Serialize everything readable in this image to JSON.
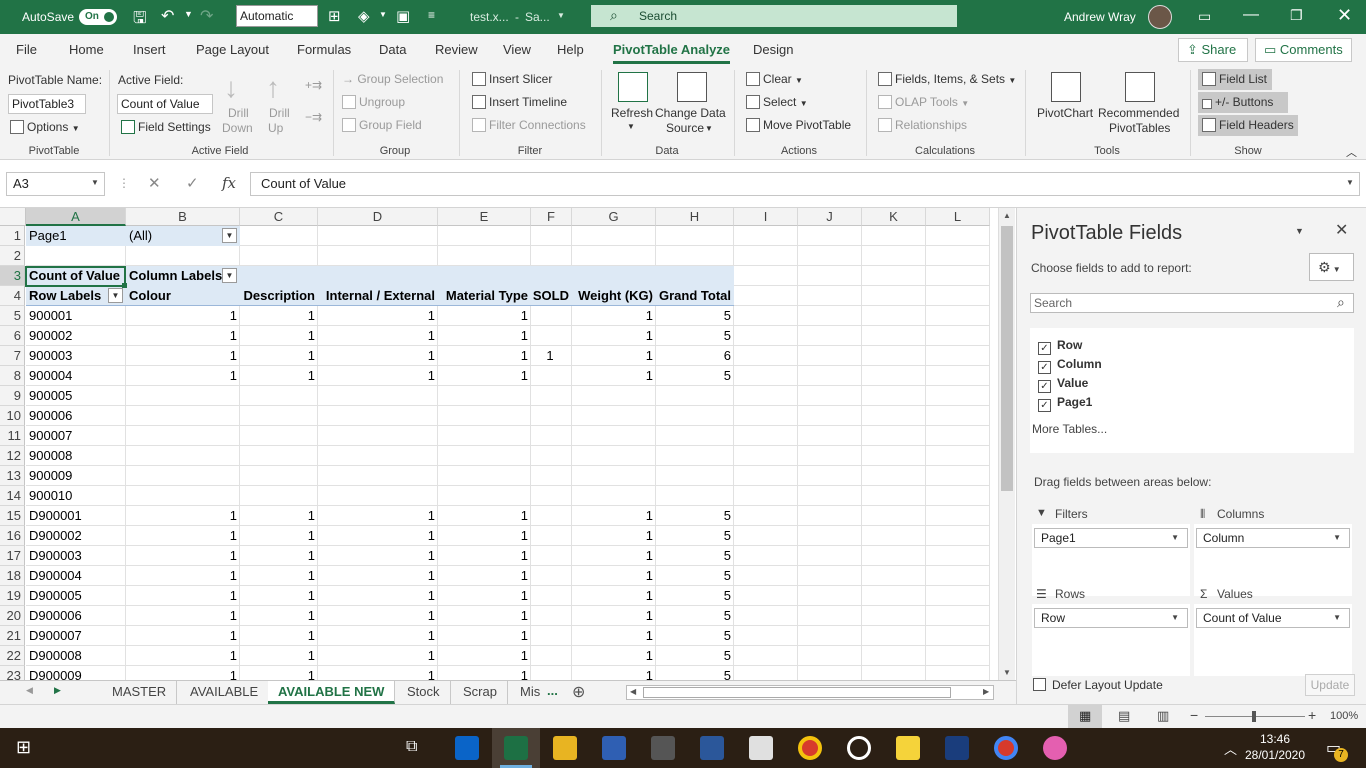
{
  "titlebar": {
    "autosave_label": "AutoSave",
    "autosave_state": "On",
    "calc_mode": "Automatic",
    "file_name": "test.x...",
    "save_state": "Sa...",
    "search_placeholder": "Search",
    "user_name": "Andrew Wray"
  },
  "menu": {
    "tabs": [
      "File",
      "Home",
      "Insert",
      "Page Layout",
      "Formulas",
      "Data",
      "Review",
      "View",
      "Help",
      "PivotTable Analyze",
      "Design"
    ],
    "share": "Share",
    "comments": "Comments"
  },
  "ribbon": {
    "pivottable_name_label": "PivotTable Name:",
    "pivottable_name_value": "PivotTable3",
    "options": "Options",
    "active_field_label": "Active Field:",
    "active_field_value": "Count of Value",
    "field_settings": "Field Settings",
    "drill_down_1": "Drill",
    "drill_down_2": "Down",
    "drill_up_1": "Drill",
    "drill_up_2": "Up",
    "group_selection": "Group Selection",
    "ungroup": "Ungroup",
    "group_field": "Group Field",
    "insert_slicer": "Insert Slicer",
    "insert_timeline": "Insert Timeline",
    "filter_connections": "Filter Connections",
    "refresh": "Refresh",
    "change_data_source_1": "Change Data",
    "change_data_source_2": "Source",
    "clear": "Clear",
    "select": "Select",
    "move_pivottable": "Move PivotTable",
    "fields_items_sets": "Fields, Items, & Sets",
    "olap_tools": "OLAP Tools",
    "relationships": "Relationships",
    "pivotchart": "PivotChart",
    "recommended_1": "Recommended",
    "recommended_2": "PivotTables",
    "field_list": "Field List",
    "buttons": "+/- Buttons",
    "field_headers": "Field Headers",
    "groups": [
      "PivotTable",
      "Active Field",
      "Group",
      "Filter",
      "Data",
      "Actions",
      "Calculations",
      "Tools",
      "Show"
    ]
  },
  "formula_bar": {
    "name_box": "A3",
    "fx": "fx",
    "content": "Count of Value"
  },
  "grid": {
    "columns": [
      "A",
      "B",
      "C",
      "D",
      "E",
      "F",
      "G",
      "H",
      "I",
      "J",
      "K",
      "L"
    ],
    "rows": [
      "1",
      "2",
      "3",
      "4",
      "5",
      "6",
      "7",
      "8",
      "9",
      "10",
      "11",
      "12",
      "13",
      "14",
      "15",
      "16",
      "17",
      "18",
      "19",
      "20",
      "21",
      "22",
      "23"
    ],
    "page_field": "Page1",
    "page_value": "(All)",
    "count_label": "Count of Value",
    "column_labels": "Column Labels",
    "row_labels": "Row Labels",
    "headers": [
      "Colour",
      "Description",
      "Internal / External",
      "Material Type",
      "SOLD",
      "Weight (KG)",
      "Grand Total"
    ],
    "data_rows": [
      {
        "label": "900001",
        "values": [
          "1",
          "1",
          "1",
          "1",
          "",
          "1",
          "5"
        ]
      },
      {
        "label": "900002",
        "values": [
          "1",
          "1",
          "1",
          "1",
          "",
          "1",
          "5"
        ]
      },
      {
        "label": "900003",
        "values": [
          "1",
          "1",
          "1",
          "1",
          "1",
          "1",
          "6"
        ]
      },
      {
        "label": "900004",
        "values": [
          "1",
          "1",
          "1",
          "1",
          "",
          "1",
          "5"
        ]
      },
      {
        "label": "900005",
        "values": [
          "",
          "",
          "",
          "",
          "",
          "",
          ""
        ]
      },
      {
        "label": "900006",
        "values": [
          "",
          "",
          "",
          "",
          "",
          "",
          ""
        ]
      },
      {
        "label": "900007",
        "values": [
          "",
          "",
          "",
          "",
          "",
          "",
          ""
        ]
      },
      {
        "label": "900008",
        "values": [
          "",
          "",
          "",
          "",
          "",
          "",
          ""
        ]
      },
      {
        "label": "900009",
        "values": [
          "",
          "",
          "",
          "",
          "",
          "",
          ""
        ]
      },
      {
        "label": "900010",
        "values": [
          "",
          "",
          "",
          "",
          "",
          "",
          ""
        ]
      },
      {
        "label": "D900001",
        "values": [
          "1",
          "1",
          "1",
          "1",
          "",
          "1",
          "5"
        ]
      },
      {
        "label": "D900002",
        "values": [
          "1",
          "1",
          "1",
          "1",
          "",
          "1",
          "5"
        ]
      },
      {
        "label": "D900003",
        "values": [
          "1",
          "1",
          "1",
          "1",
          "",
          "1",
          "5"
        ]
      },
      {
        "label": "D900004",
        "values": [
          "1",
          "1",
          "1",
          "1",
          "",
          "1",
          "5"
        ]
      },
      {
        "label": "D900005",
        "values": [
          "1",
          "1",
          "1",
          "1",
          "",
          "1",
          "5"
        ]
      },
      {
        "label": "D900006",
        "values": [
          "1",
          "1",
          "1",
          "1",
          "",
          "1",
          "5"
        ]
      },
      {
        "label": "D900007",
        "values": [
          "1",
          "1",
          "1",
          "1",
          "",
          "1",
          "5"
        ]
      },
      {
        "label": "D900008",
        "values": [
          "1",
          "1",
          "1",
          "1",
          "",
          "1",
          "5"
        ]
      },
      {
        "label": "D900009",
        "values": [
          "1",
          "1",
          "1",
          "1",
          "",
          "1",
          "5"
        ]
      }
    ]
  },
  "sheet_tabs": [
    "MASTER",
    "AVAILABLE",
    "AVAILABLE NEW",
    "Stock",
    "Scrap",
    "Mis"
  ],
  "sheet_tabs_more": "...",
  "pane": {
    "title": "PivotTable Fields",
    "choose": "Choose fields to add to report:",
    "search": "Search",
    "fields": [
      "Row",
      "Column",
      "Value",
      "Page1"
    ],
    "more_tables": "More Tables...",
    "drag": "Drag fields between areas below:",
    "filters_label": "Filters",
    "filters_value": "Page1",
    "columns_label": "Columns",
    "columns_value": "Column",
    "rows_label": "Rows",
    "rows_value": "Row",
    "values_label": "Values",
    "values_value": "Count of Value",
    "defer": "Defer Layout Update",
    "update": "Update"
  },
  "status": {
    "zoom": "100%"
  },
  "taskbar": {
    "time": "13:46",
    "date": "28/01/2020",
    "notifications": "7"
  },
  "colors": {
    "excel_green": "#217346",
    "pivot_header": "#dde9f5",
    "taskbar": "#2b1f14"
  }
}
